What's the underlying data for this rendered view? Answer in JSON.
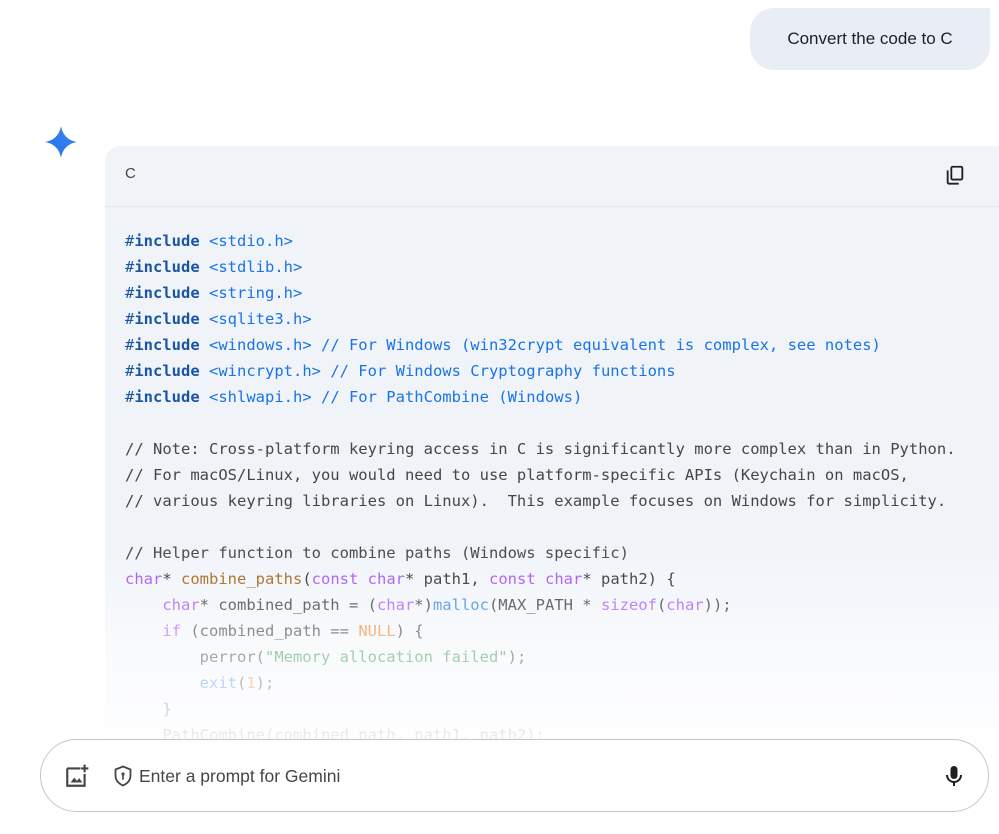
{
  "user_message": "Convert the code to C",
  "response": {
    "language_label": "C",
    "copy_icon": "copy-icon",
    "code_lines": [
      [
        {
          "t": "#",
          "c": "#1a55a5"
        },
        {
          "t": "include",
          "c": "#1a55a5",
          "b": true
        },
        {
          "t": " <stdio.h>",
          "c": "#1a73e8"
        }
      ],
      [
        {
          "t": "#",
          "c": "#1a55a5"
        },
        {
          "t": "include",
          "c": "#1a55a5",
          "b": true
        },
        {
          "t": " <stdlib.h>",
          "c": "#1a73e8"
        }
      ],
      [
        {
          "t": "#",
          "c": "#1a55a5"
        },
        {
          "t": "include",
          "c": "#1a55a5",
          "b": true
        },
        {
          "t": " <string.h>",
          "c": "#1a73e8"
        }
      ],
      [
        {
          "t": "#",
          "c": "#1a55a5"
        },
        {
          "t": "include",
          "c": "#1a55a5",
          "b": true
        },
        {
          "t": " <sqlite3.h>",
          "c": "#1a73e8"
        }
      ],
      [
        {
          "t": "#",
          "c": "#1a55a5"
        },
        {
          "t": "include",
          "c": "#1a55a5",
          "b": true
        },
        {
          "t": " <windows.h> // For Windows (win32crypt equivalent is complex, see notes)",
          "c": "#1a73e8"
        }
      ],
      [
        {
          "t": "#",
          "c": "#1a55a5"
        },
        {
          "t": "include",
          "c": "#1a55a5",
          "b": true
        },
        {
          "t": " <wincrypt.h> // For Windows Cryptography functions",
          "c": "#1a73e8"
        }
      ],
      [
        {
          "t": "#",
          "c": "#1a55a5"
        },
        {
          "t": "include",
          "c": "#1a55a5",
          "b": true
        },
        {
          "t": " <shlwapi.h> // For PathCombine (Windows)",
          "c": "#1a73e8"
        }
      ],
      [],
      [
        {
          "t": "// Note: Cross-platform keyring access in C is significantly more complex than in Python.",
          "c": "#444746"
        }
      ],
      [
        {
          "t": "// For macOS/Linux, you would need to use platform-specific APIs (Keychain on macOS,",
          "c": "#444746"
        }
      ],
      [
        {
          "t": "// various keyring libraries on Linux).  This example focuses on Windows for simplicity.",
          "c": "#444746"
        }
      ],
      [],
      [
        {
          "t": "// Helper function to combine paths (Windows specific)",
          "c": "#444746"
        }
      ],
      [
        {
          "t": "char",
          "c": "#a142f4"
        },
        {
          "t": "* ",
          "c": "#1f1f1f"
        },
        {
          "t": "combine_paths",
          "c": "#9c5700"
        },
        {
          "t": "(",
          "c": "#1f1f1f"
        },
        {
          "t": "const char",
          "c": "#a142f4"
        },
        {
          "t": "* path1, ",
          "c": "#1f1f1f"
        },
        {
          "t": "const char",
          "c": "#a142f4"
        },
        {
          "t": "* path2) {",
          "c": "#1f1f1f"
        }
      ],
      [
        {
          "t": "    ",
          "c": "#1f1f1f"
        },
        {
          "t": "char",
          "c": "#a142f4"
        },
        {
          "t": "* combined_path = (",
          "c": "#1f1f1f"
        },
        {
          "t": "char",
          "c": "#a142f4"
        },
        {
          "t": "*)",
          "c": "#1f1f1f"
        },
        {
          "t": "malloc",
          "c": "#1a73e8"
        },
        {
          "t": "(MAX_PATH * ",
          "c": "#1f1f1f"
        },
        {
          "t": "sizeof",
          "c": "#a142f4"
        },
        {
          "t": "(",
          "c": "#1f1f1f"
        },
        {
          "t": "char",
          "c": "#a142f4"
        },
        {
          "t": "));",
          "c": "#1f1f1f"
        }
      ],
      [
        {
          "t": "    ",
          "c": "#1f1f1f"
        },
        {
          "t": "if",
          "c": "#a142f4"
        },
        {
          "t": " (combined_path == ",
          "c": "#1f1f1f"
        },
        {
          "t": "NULL",
          "c": "#e8710a"
        },
        {
          "t": ") {",
          "c": "#1f1f1f"
        }
      ],
      [
        {
          "t": "        perror(",
          "c": "#1f1f1f"
        },
        {
          "t": "\"Memory allocation failed\"",
          "c": "#188038"
        },
        {
          "t": ");",
          "c": "#1f1f1f"
        }
      ],
      [
        {
          "t": "        ",
          "c": "#1f1f1f"
        },
        {
          "t": "exit",
          "c": "#1a73e8"
        },
        {
          "t": "(",
          "c": "#1f1f1f"
        },
        {
          "t": "1",
          "c": "#e8710a"
        },
        {
          "t": ");",
          "c": "#1f1f1f"
        }
      ],
      [
        {
          "t": "    }",
          "c": "#1f1f1f"
        }
      ],
      [
        {
          "t": "    PathCombine(combined_path, path1, path2);",
          "c": "#1f1f1f"
        }
      ]
    ]
  },
  "prompt": {
    "placeholder": "Enter a prompt for Gemini",
    "value": ""
  },
  "icons": {
    "sparkle": "gemini-sparkle-icon",
    "add_image": "add-image-icon",
    "shield": "shield-icon",
    "mic": "mic-icon"
  }
}
